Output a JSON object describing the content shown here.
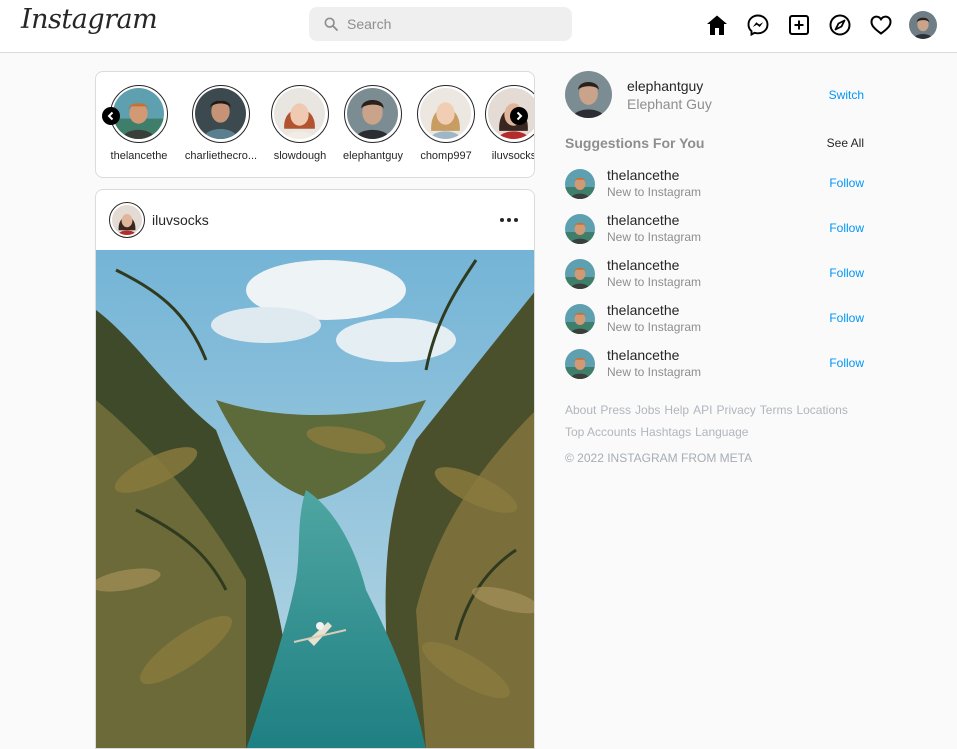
{
  "nav": {
    "logo": "Instagram",
    "search_placeholder": "Search",
    "icons": [
      "home-icon",
      "messenger-icon",
      "new-post-icon",
      "explore-icon",
      "activity-icon"
    ]
  },
  "stories": [
    {
      "username": "thelancethe"
    },
    {
      "username": "charliethecro..."
    },
    {
      "username": "slowdough"
    },
    {
      "username": "elephantguy"
    },
    {
      "username": "chomp997"
    },
    {
      "username": "iluvsocks"
    }
  ],
  "post": {
    "username": "iluvsocks"
  },
  "me": {
    "username": "elephantguy",
    "full_name": "Elephant Guy",
    "switch_label": "Switch"
  },
  "suggestions": {
    "title": "Suggestions For You",
    "see_all": "See All",
    "items": [
      {
        "username": "thelancethe",
        "subtitle": "New to Instagram",
        "action": "Follow"
      },
      {
        "username": "thelancethe",
        "subtitle": "New to Instagram",
        "action": "Follow"
      },
      {
        "username": "thelancethe",
        "subtitle": "New to Instagram",
        "action": "Follow"
      },
      {
        "username": "thelancethe",
        "subtitle": "New to Instagram",
        "action": "Follow"
      },
      {
        "username": "thelancethe",
        "subtitle": "New to Instagram",
        "action": "Follow"
      }
    ]
  },
  "footer": {
    "links": [
      "About",
      "Press",
      "Jobs",
      "Help",
      "API",
      "Privacy",
      "Terms",
      "Locations",
      "Top Accounts",
      "Hashtags",
      "Language"
    ],
    "copyright": "© 2022 INSTAGRAM FROM META"
  },
  "colors": {
    "link_blue": "#0095f6",
    "muted_text": "#8e8e8e",
    "border": "#dbdbdb"
  }
}
